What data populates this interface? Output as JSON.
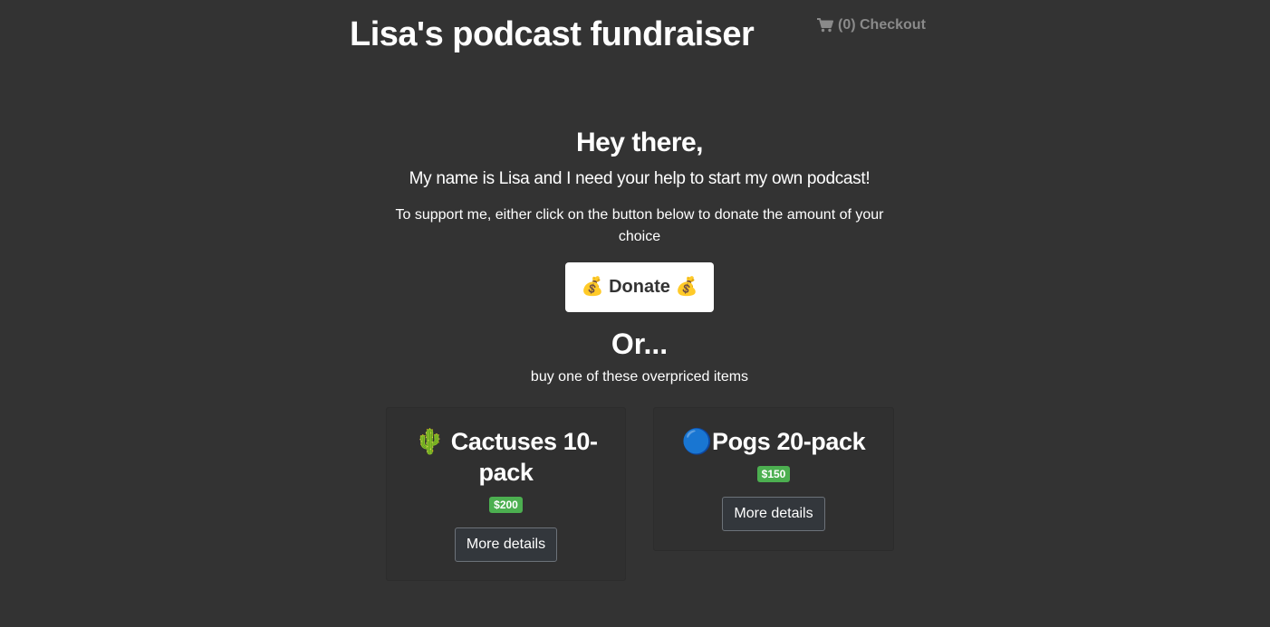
{
  "header": {
    "title": "Lisa's podcast fundraiser",
    "checkout_label": "(0) Checkout",
    "cart_icon": "shopping-cart-icon"
  },
  "hero": {
    "greeting": "Hey there,",
    "intro": "My name is Lisa and I need your help to start my own podcast!",
    "support_text": "To support me, either click on the button below to donate the amount of your choice",
    "donate_label": "💰 Donate 💰",
    "or_heading": "Or...",
    "sub_text": "buy one of these overpriced items"
  },
  "products": [
    {
      "title": "🌵 Cactuses 10-pack",
      "price": "$200",
      "button_label": "More details"
    },
    {
      "title": "🔵Pogs 20-pack",
      "price": "$150",
      "button_label": "More details"
    }
  ],
  "colors": {
    "background": "#333333",
    "price_badge": "#4caf50",
    "checkout_text": "#8a8a8a"
  }
}
